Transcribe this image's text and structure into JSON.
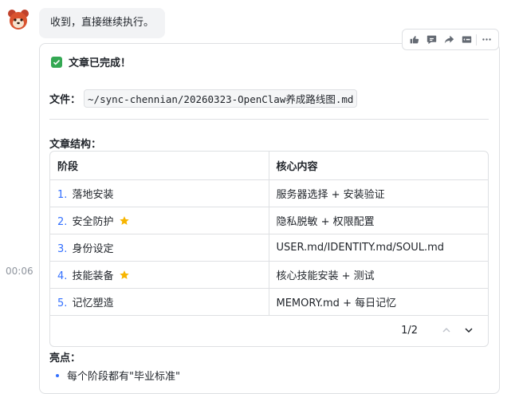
{
  "user_message": "收到，直接继续执行。",
  "time_label": "00:06",
  "toolbar": {
    "icons": [
      "thumbs-up-icon",
      "comment-icon",
      "forward-icon",
      "quote-icon",
      "more-icon"
    ]
  },
  "card": {
    "done_text": "文章已完成！",
    "file_label": "文件：",
    "file_path": "~/sync-chennian/20260323-OpenClaw养成路线图.md",
    "structure_title": "文章结构：",
    "table": {
      "headers": [
        "阶段",
        "核心内容"
      ],
      "rows": [
        {
          "index": "1.",
          "stage": "落地安装",
          "content": "服务器选择 + 安装验证",
          "star": false
        },
        {
          "index": "2.",
          "stage": "安全防护",
          "content": "隐私脱敏 + 权限配置",
          "star": true
        },
        {
          "index": "3.",
          "stage": "身份设定",
          "content": "USER.md/IDENTITY.md/SOUL.md",
          "star": false
        },
        {
          "index": "4.",
          "stage": "技能装备",
          "content": "核心技能安装 + 测试",
          "star": true
        },
        {
          "index": "5.",
          "stage": "记忆塑造",
          "content": "MEMORY.md + 每日记忆",
          "star": false
        }
      ],
      "pager": "1/2"
    },
    "highlights_title": "亮点：",
    "highlights": [
      "每个阶段都有\"毕业标准\""
    ]
  },
  "colors": {
    "accent": "#3370ff",
    "check": "#34a853",
    "star": "#f7b500"
  }
}
